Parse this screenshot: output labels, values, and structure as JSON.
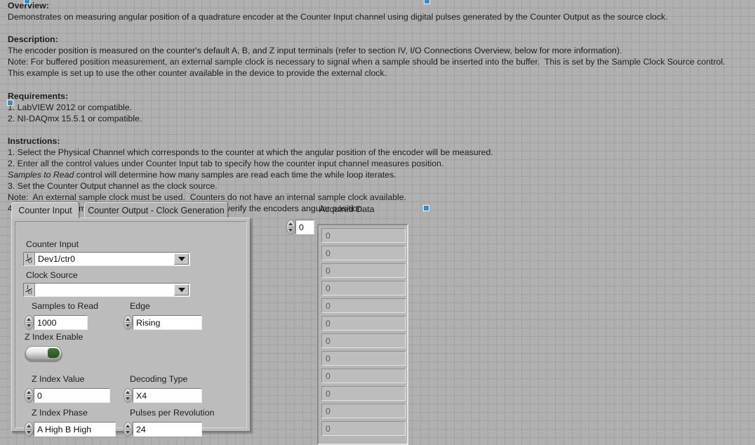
{
  "doc": {
    "overview_heading": "Overview:",
    "overview_line": "Demonstrates on measuring angular position of a quadrature encoder at the Counter Input channel using digital pulses generated by the Counter Output as the source clock.",
    "description_heading": "Description:",
    "description_lines": [
      "The encoder position is measured on the counter's default A, B, and Z input terminals (refer to section IV, I/O Connections Overview, below for more information).",
      "Note: For buffered position measurement, an external sample clock is necessary to signal when a sample should be inserted into the buffer.  This is set by the Sample Clock Source control.",
      "This example is set up to use the other counter available in the device to provide the external clock."
    ],
    "requirements_heading": "Requirements:",
    "requirements_lines": [
      "1. LabVIEW 2012 or compatible.",
      "2. NI-DAQmx 15.5.1 or compatible."
    ],
    "instructions_heading": "Instructions:",
    "instructions_lines": [
      "1. Select the Physical Channel which corresponds to the counter at which the angular position of the encoder will be measured.",
      "2. Enter all the control values under Counter Input tab to specify how the counter input channel measures position.",
      "3. Set the Counter Output channel as the clock source.",
      "4. Run this VI and monitor the "
    ],
    "samples_italic": "Samples to Read",
    "samples_rest": " control will determine how many samples are read each time the while loop iterates.",
    "note_line": "Note:  An external sample clock must be used.  Counters do not have an internal sample clock available.",
    "acquired_italic": "Acquired Data",
    "acquired_rest": " indicator to verify the encoders angular position."
  },
  "tabs": [
    {
      "label": "Counter Input",
      "selected": true
    },
    {
      "label": "Counter Output - Clock Generation",
      "selected": false
    }
  ],
  "counter_input_page": {
    "counter_input": {
      "label": "Counter Input",
      "value": "Dev1/ctr0",
      "icon": "io-name-icon",
      "dropdown_icon": "chevron-down-icon"
    },
    "clock_source": {
      "label": "Clock Source",
      "value": "",
      "icon": "io-name-icon",
      "dropdown_icon": "chevron-down-icon"
    },
    "samples_to_read": {
      "label": "Samples to Read",
      "value": "1000",
      "icon": "spinner-icon"
    },
    "edge": {
      "label": "Edge",
      "value": "Rising",
      "icon": "spinner-icon"
    },
    "z_index_enable": {
      "label": "Z Index Enable",
      "state": "off",
      "icon": "rocker-switch-icon"
    },
    "z_index_value": {
      "label": "Z Index Value",
      "value": "0",
      "icon": "spinner-icon"
    },
    "decoding_type": {
      "label": "Decoding Type",
      "value": "X4",
      "icon": "spinner-icon"
    },
    "z_index_phase": {
      "label": "Z Index Phase",
      "value": "A High B High",
      "icon": "spinner-icon"
    },
    "pulses_per_revolution": {
      "label": "Pulses per Revolution",
      "value": "24",
      "icon": "spinner-icon"
    }
  },
  "acquired_data": {
    "label": "Acquired Data",
    "index_value": "0",
    "index_icon": "spinner-icon",
    "elements": [
      "0",
      "0",
      "0",
      "0",
      "0",
      "0",
      "0",
      "0",
      "0",
      "0",
      "0",
      "0"
    ]
  },
  "colors": {
    "panel_background": "#b0b0b0",
    "grid_line": "#a2a2a2",
    "control_face": "#bdbdbd",
    "field_background": "#ffffff",
    "selection_handle": "#2a8fe0",
    "toggle_green": "#3f7a33",
    "text": "#1d1d1d"
  }
}
